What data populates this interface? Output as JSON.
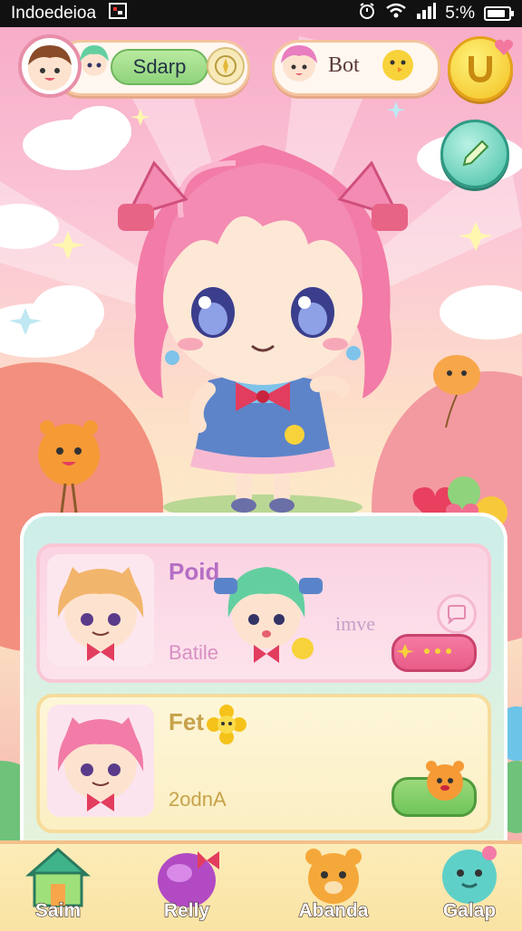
{
  "status_bar": {
    "carrier": "Indoedeioa",
    "battery": "5:%",
    "battery_level": 0.85
  },
  "hud": {
    "player_name": "Sdarp",
    "friend_name": "Bot"
  },
  "cards": [
    {
      "title": "Poid",
      "subtitle": "Batile",
      "status": "imve"
    },
    {
      "title": "Fet",
      "subtitle": "2odnA"
    }
  ],
  "nav": [
    {
      "label": "Saim",
      "icon": "house-icon"
    },
    {
      "label": "Relly",
      "icon": "gift-icon"
    },
    {
      "label": "Abanda",
      "icon": "bear-icon"
    },
    {
      "label": "Galap",
      "icon": "slime-icon"
    }
  ],
  "colors": {
    "accent_pink": "#f48fb1",
    "accent_green": "#8fd37c",
    "gold": "#f7c93a",
    "teal": "#4fc3b2"
  }
}
